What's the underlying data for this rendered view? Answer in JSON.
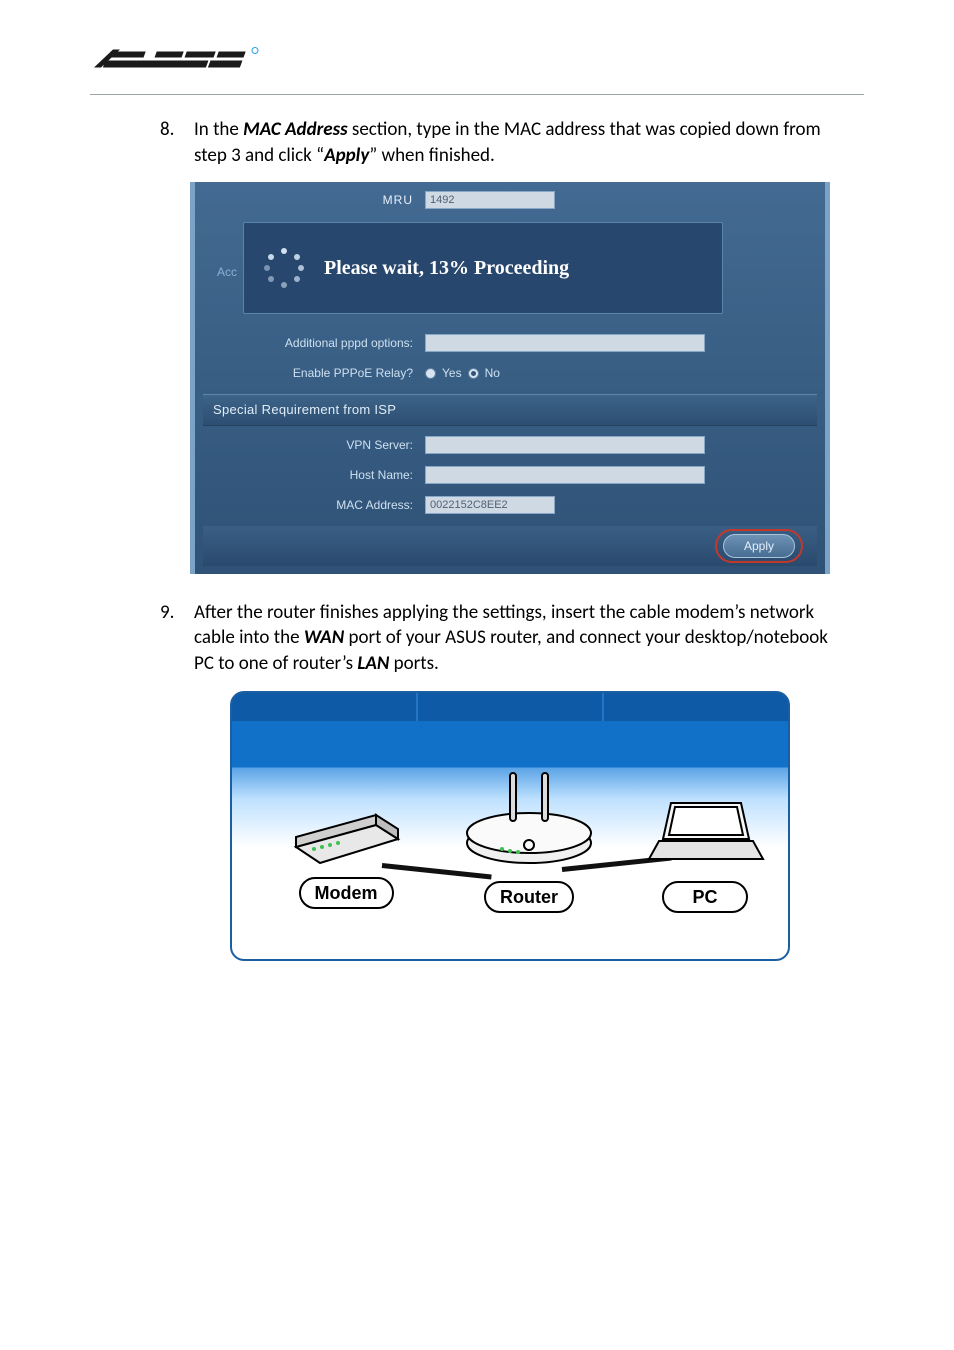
{
  "logo": {
    "brand": "ASUS"
  },
  "steps": {
    "s8": {
      "num": "8.",
      "pre": "In the ",
      "b1": "MAC Address",
      "mid": " section, type in the MAC address that was copied down from step 3 and click “",
      "b2": "Apply",
      "post": "” when finished."
    },
    "s9": {
      "num": "9.",
      "pre": "After the router finishes applying the settings, insert the cable modem’s network cable into the ",
      "b1": "WAN",
      "mid": " port of your ASUS router, and connect your desktop/notebook PC to one of router’s ",
      "b2": "LAN",
      "post": " ports."
    }
  },
  "shot": {
    "mru_label": "MRU",
    "mru_value": "1492",
    "acc_ghost": "Acc",
    "modal_text": "Please wait, 13% Proceeding",
    "addl_label": "Additional pppd options:",
    "addl_value": "",
    "relay_label": "Enable PPPoE Relay?",
    "relay_yes": "Yes",
    "relay_no": "No",
    "section_title": "Special Requirement from ISP",
    "vpn_label": "VPN Server:",
    "vpn_value": "",
    "host_label": "Host Name:",
    "host_value": "",
    "mac_label": "MAC Address:",
    "mac_value": "0022152C8EE2",
    "apply_label": "Apply"
  },
  "diagram": {
    "modem": "Modem",
    "router": "Router",
    "pc": "PC"
  }
}
